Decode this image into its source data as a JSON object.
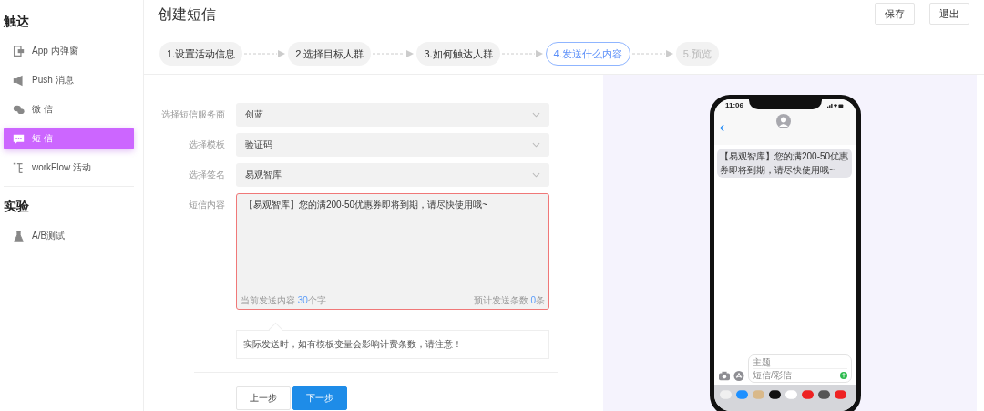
{
  "sidebar": {
    "groups": [
      {
        "title": "触达",
        "items": [
          {
            "label": "App 内弹窗",
            "selected": false
          },
          {
            "label": "Push 消息",
            "selected": false
          },
          {
            "label": "微 信",
            "selected": false
          },
          {
            "label": "短 信",
            "selected": true
          },
          {
            "label": "workFlow 活动",
            "selected": false
          }
        ]
      },
      {
        "title": "实验",
        "items": [
          {
            "label": "A/B测试",
            "selected": false
          }
        ]
      }
    ]
  },
  "header": {
    "title": "创建短信",
    "buttons": [
      "保存",
      "退出"
    ]
  },
  "steps": [
    {
      "label": "1.设置活动信息",
      "selected": false,
      "disabled": false
    },
    {
      "label": "2.选择目标人群",
      "selected": false,
      "disabled": false
    },
    {
      "label": "3.如何触达人群",
      "selected": false,
      "disabled": false
    },
    {
      "label": "4.发送什么内容",
      "selected": true,
      "disabled": false
    },
    {
      "label": "5.预览",
      "selected": false,
      "disabled": true
    }
  ],
  "form": {
    "selects": [
      {
        "label": "选择短信服务商",
        "value": "创蓝"
      },
      {
        "label": "选择模板",
        "value": "验证码"
      },
      {
        "label": "选择签名",
        "value": "易观智库"
      }
    ],
    "content": {
      "label": "短信内容",
      "value": "【易观智库】您的满200-50优惠券即将到期，请尽快使用哦~",
      "invalid": true,
      "count": {
        "prefix": "当前发送内容",
        "number": "30",
        "suffix": "个字"
      },
      "estimate": {
        "prefix": "预计发送条数",
        "number": "0",
        "suffix": "条"
      }
    },
    "notice": "实际发送时，如有模板变量会影响计费条数，请注意！"
  },
  "actions": [
    {
      "label": "上一步",
      "kind": "default"
    },
    {
      "label": "下一步",
      "kind": "primary"
    }
  ],
  "phone": {
    "time": "11:06",
    "message": "【易观智库】您的满200-50优惠券即将到期，请尽快使用哦~",
    "subject_placeholder": "主题",
    "body_placeholder": "短信/彩信"
  }
}
